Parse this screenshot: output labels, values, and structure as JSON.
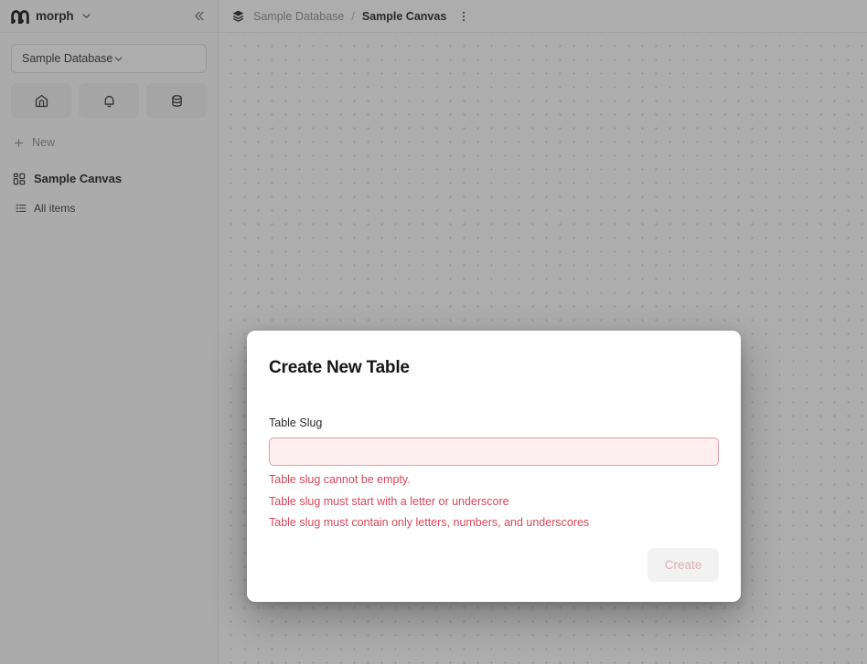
{
  "sidebar": {
    "brand": {
      "name": "morph",
      "logo_icon": "morph-logo-icon",
      "caret_icon": "chevron-down-icon"
    },
    "collapse_icon": "chevrons-left-icon",
    "database_select": {
      "value": "Sample Database",
      "caret_icon": "chevron-down-icon"
    },
    "icon_buttons": [
      {
        "name": "home",
        "icon": "home-icon"
      },
      {
        "name": "notifications",
        "icon": "bell-icon"
      },
      {
        "name": "database",
        "icon": "database-icon"
      }
    ],
    "new_item": {
      "label": "New",
      "icon": "plus-icon"
    },
    "canvas_item": {
      "label": "Sample Canvas",
      "icon": "layout-grid-icon"
    },
    "all_items": {
      "label": "All items",
      "icon": "list-icon"
    }
  },
  "topbar": {
    "crumb_icon": "layers-icon",
    "breadcrumb_parent": "Sample Database",
    "breadcrumb_separator": "/",
    "breadcrumb_current": "Sample Canvas",
    "more_icon": "dots-vertical-icon"
  },
  "modal": {
    "title": "Create New Table",
    "field_label": "Table Slug",
    "input_value": "",
    "input_placeholder": "",
    "errors": [
      "Table slug cannot be empty.",
      "Table slug must start with a letter or underscore",
      "Table slug must contain only letters, numbers, and underscores"
    ],
    "create_label": "Create"
  },
  "colors": {
    "error_text": "#d6475a",
    "input_border": "#e79ba1",
    "input_background": "#fdeff0",
    "disabled_button_bg": "#f2f2f3",
    "disabled_button_text": "#e0aeb5",
    "canvas_dot": "#d2d2d2",
    "overlay": "rgba(60,60,60,0.42)"
  }
}
